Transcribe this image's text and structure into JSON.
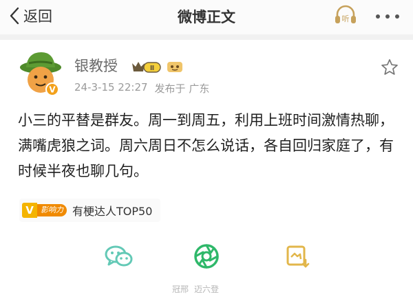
{
  "nav": {
    "back_label": "返回",
    "title": "微博正文",
    "listen_label": "听"
  },
  "author": {
    "name": "银教授",
    "level_badge": "Ⅱ",
    "verified_mark": "V"
  },
  "post": {
    "time": "24-3-15 22:27",
    "location": "发布于 广东",
    "text": "小三的平替是群友。周一到周五，利用上班时间激情热聊，满嘴虎狼之词。周六周日不怎么说话，各自回归家庭了，有时候半夜也聊几句。"
  },
  "tag": {
    "badge_letter": "V",
    "badge_text": "影响力",
    "label": "有梗达人TOP50"
  },
  "watermark": {
    "left": "冠邢",
    "right": "迈六登"
  },
  "colors": {
    "accent_green": "#2fb86a",
    "wechat_teal": "#63c9b6",
    "tag_orange": "#f4b400"
  }
}
